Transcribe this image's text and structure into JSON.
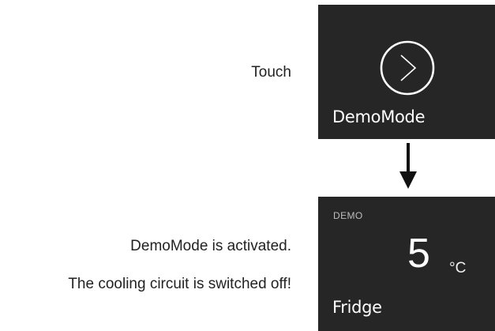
{
  "step1": {
    "instruction": "Touch",
    "button_icon": "circle-chevron-right-icon",
    "caption": "DemoMode"
  },
  "transition": {
    "icon": "down-arrow-icon"
  },
  "step2": {
    "status_line1": "DemoMode is activated.",
    "status_line2": "The cooling circuit is switched off!",
    "display": {
      "mode_tag": "DEMO",
      "temperature": "5",
      "unit": "°C",
      "compartment": "Fridge"
    }
  },
  "colors": {
    "panel_background": "#262626",
    "panel_text": "#ffffff",
    "label_text": "#222222"
  }
}
